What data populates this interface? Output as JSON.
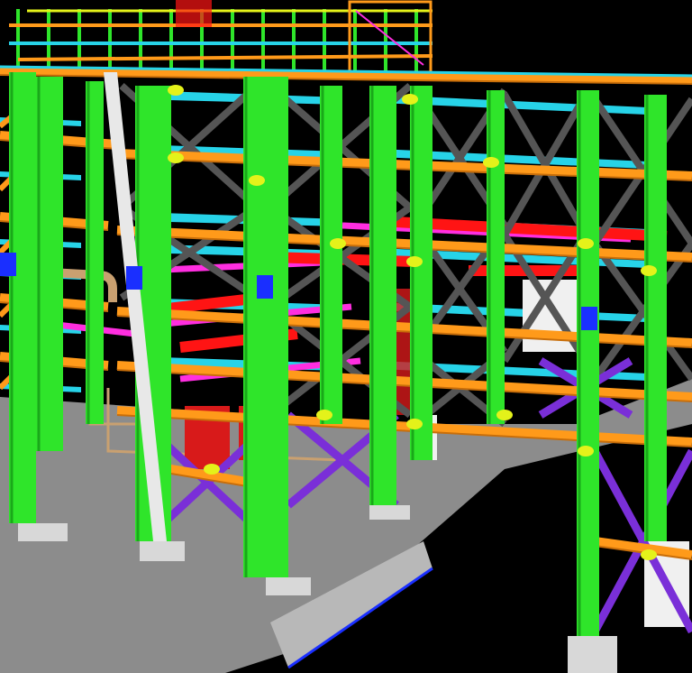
{
  "scene": {
    "palette": {
      "background": "#000000",
      "ground": "#8c8c8c",
      "column": "#2fe52a",
      "column_dark": "#1aa81a",
      "beam": "#ff9a1a",
      "beam_dark": "#c86e0a",
      "cross_brace": "#555555",
      "lower_brace": "#7a2fd8",
      "decking": "#27d3e8",
      "magenta_beam": "#ff2ee0",
      "red_beam": "#ff1414",
      "splice_plate": "#1a2fff",
      "gusset": "#e4f21a",
      "white_column": "#e8e8e8",
      "footing": "#d8d8d8",
      "pipe": "#c9a070",
      "equipment_red": "#d81a1a"
    }
  }
}
